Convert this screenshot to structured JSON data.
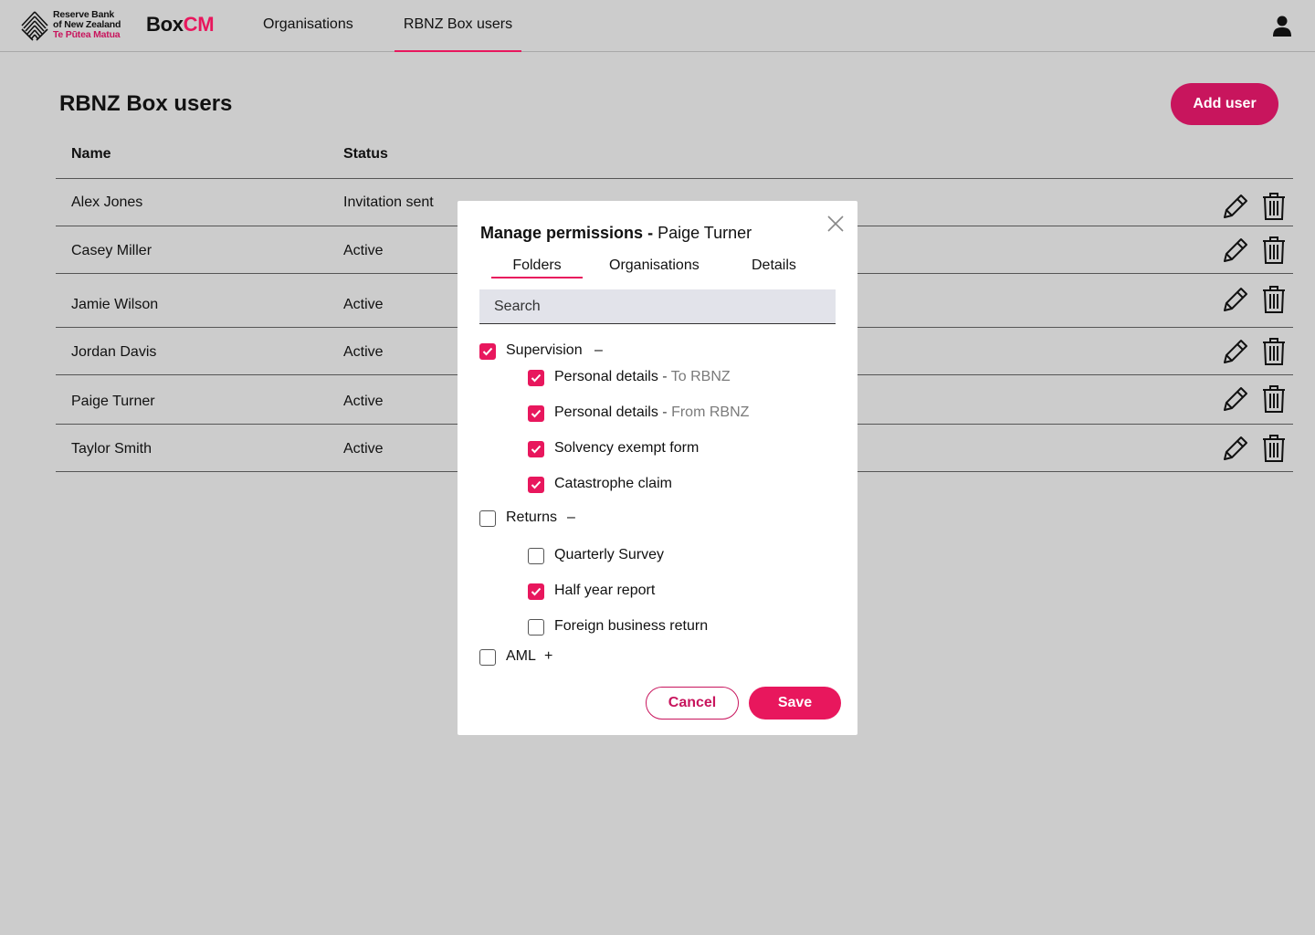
{
  "header": {
    "logo": {
      "line1": "Reserve Bank",
      "line2": "of New Zealand",
      "line3": "Te Pūtea Matua"
    },
    "product": {
      "part1": "Box",
      "part2": "CM"
    },
    "nav": [
      {
        "label": "Organisations",
        "active": false
      },
      {
        "label": "RBNZ Box users",
        "active": true
      }
    ],
    "user_icon": "user-icon"
  },
  "page": {
    "title": "RBNZ Box users",
    "add_user_label": "Add user",
    "columns": {
      "name": "Name",
      "status": "Status"
    },
    "rows": [
      {
        "name": "Alex Jones",
        "status": "Invitation sent"
      },
      {
        "name": "Casey Miller",
        "status": "Active"
      },
      {
        "name": "Jamie Wilson",
        "status": "Active"
      },
      {
        "name": "Jordan Davis",
        "status": "Active"
      },
      {
        "name": "Paige Turner",
        "status": "Active"
      },
      {
        "name": "Taylor Smith",
        "status": "Active"
      }
    ],
    "row_icons": [
      "pencil-icon",
      "trash-icon"
    ]
  },
  "modal": {
    "title_label": "Manage permissions",
    "title_sep": " - ",
    "title_user": "Paige Turner",
    "tabs": [
      {
        "label": "Folders",
        "active": true
      },
      {
        "label": "Organisations",
        "active": false
      },
      {
        "label": "Details",
        "active": false
      }
    ],
    "search_placeholder": "Search",
    "groups": [
      {
        "label": "Supervision",
        "checked": true,
        "toggle": "–",
        "items": [
          {
            "label": "Personal details",
            "sep": " - ",
            "sub": "To RBNZ",
            "checked": true
          },
          {
            "label": "Personal details",
            "sep": " - ",
            "sub": "From RBNZ",
            "checked": true
          },
          {
            "label": "Solvency exempt form",
            "checked": true
          },
          {
            "label": "Catastrophe claim",
            "checked": true
          }
        ]
      },
      {
        "label": "Returns",
        "checked": false,
        "toggle": "–",
        "items": [
          {
            "label": "Quarterly Survey",
            "checked": false
          },
          {
            "label": "Half year report",
            "checked": true
          },
          {
            "label": "Foreign business return",
            "checked": false
          }
        ]
      },
      {
        "label": "AML",
        "checked": false,
        "toggle": "+",
        "items": []
      }
    ],
    "cancel_label": "Cancel",
    "save_label": "Save"
  },
  "colors": {
    "brand": "#e8175d",
    "brand_dark": "#c8155d",
    "backdrop": "#cccccc"
  }
}
